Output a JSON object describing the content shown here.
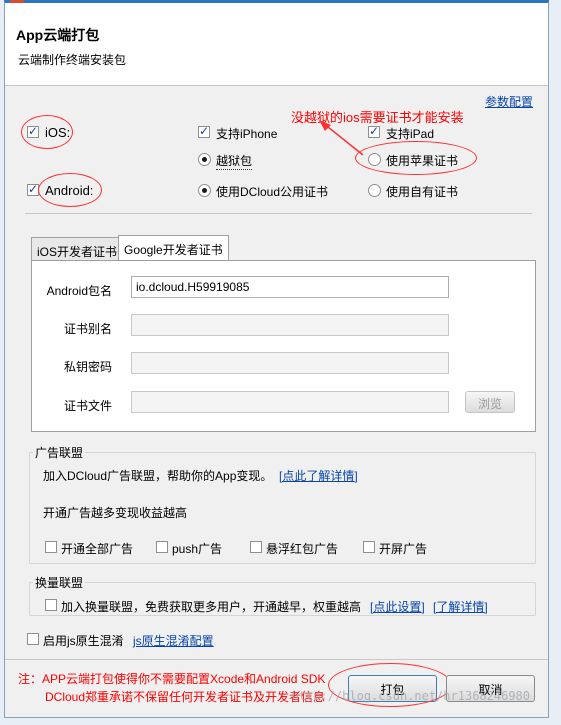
{
  "header": {
    "title": "App云端打包",
    "subtitle": "云端制作终端安装包"
  },
  "top": {
    "params_link": "参数配置",
    "annotation": "没越狱的ios需要证书才能安装"
  },
  "ios": {
    "label": "iOS:",
    "checked": true,
    "support_iphone": "支持iPhone",
    "support_iphone_checked": true,
    "support_ipad": "支持iPad",
    "support_ipad_checked": true,
    "jailbreak": "越狱包",
    "jailbreak_selected": true,
    "apple_cert": "使用苹果证书",
    "apple_cert_selected": false
  },
  "android": {
    "label": "Android:",
    "checked": true,
    "dcloud_cert": "使用DCloud公用证书",
    "dcloud_cert_selected": true,
    "own_cert": "使用自有证书",
    "own_cert_selected": false
  },
  "tabs": [
    {
      "label": "iOS开发者证书",
      "active": false
    },
    {
      "label": "Google开发者证书",
      "active": true
    }
  ],
  "google_form": {
    "package_label": "Android包名",
    "package_value": "io.dcloud.H59919085",
    "alias_label": "证书别名",
    "alias_value": "",
    "key_label": "私钥密码",
    "key_value": "",
    "file_label": "证书文件",
    "file_value": "",
    "browse_label": "浏览"
  },
  "ad_alliance": {
    "title": "广告联盟",
    "line1": "加入DCloud广告联盟，帮助你的App变现。",
    "line1_link": "[点此了解详情]",
    "line2": "开通广告越多变现收益越高",
    "options": [
      {
        "label": "开通全部广告",
        "checked": false
      },
      {
        "label": "push广告",
        "checked": false
      },
      {
        "label": "悬浮红包广告",
        "checked": false
      },
      {
        "label": "开屏广告",
        "checked": false
      }
    ]
  },
  "exchange": {
    "title": "换量联盟",
    "join_label": "加入换量联盟，免费获取更多用户，开通越早，权重越高",
    "settings_link": "[点此设置]",
    "details_link": "[了解详情]"
  },
  "js_obfuscate": {
    "label": "启用js原生混淆",
    "link": "js原生混淆配置"
  },
  "note": {
    "line1": "注：APP云端打包使得你不需要配置Xcode和Android SDK",
    "line2": "DCloud郑重承诺不保留任何开发者证书及开发者信息"
  },
  "buttons": {
    "pack": "打包",
    "cancel": "取消"
  },
  "watermark": "http://blog.csdn.net/hr1368246980"
}
